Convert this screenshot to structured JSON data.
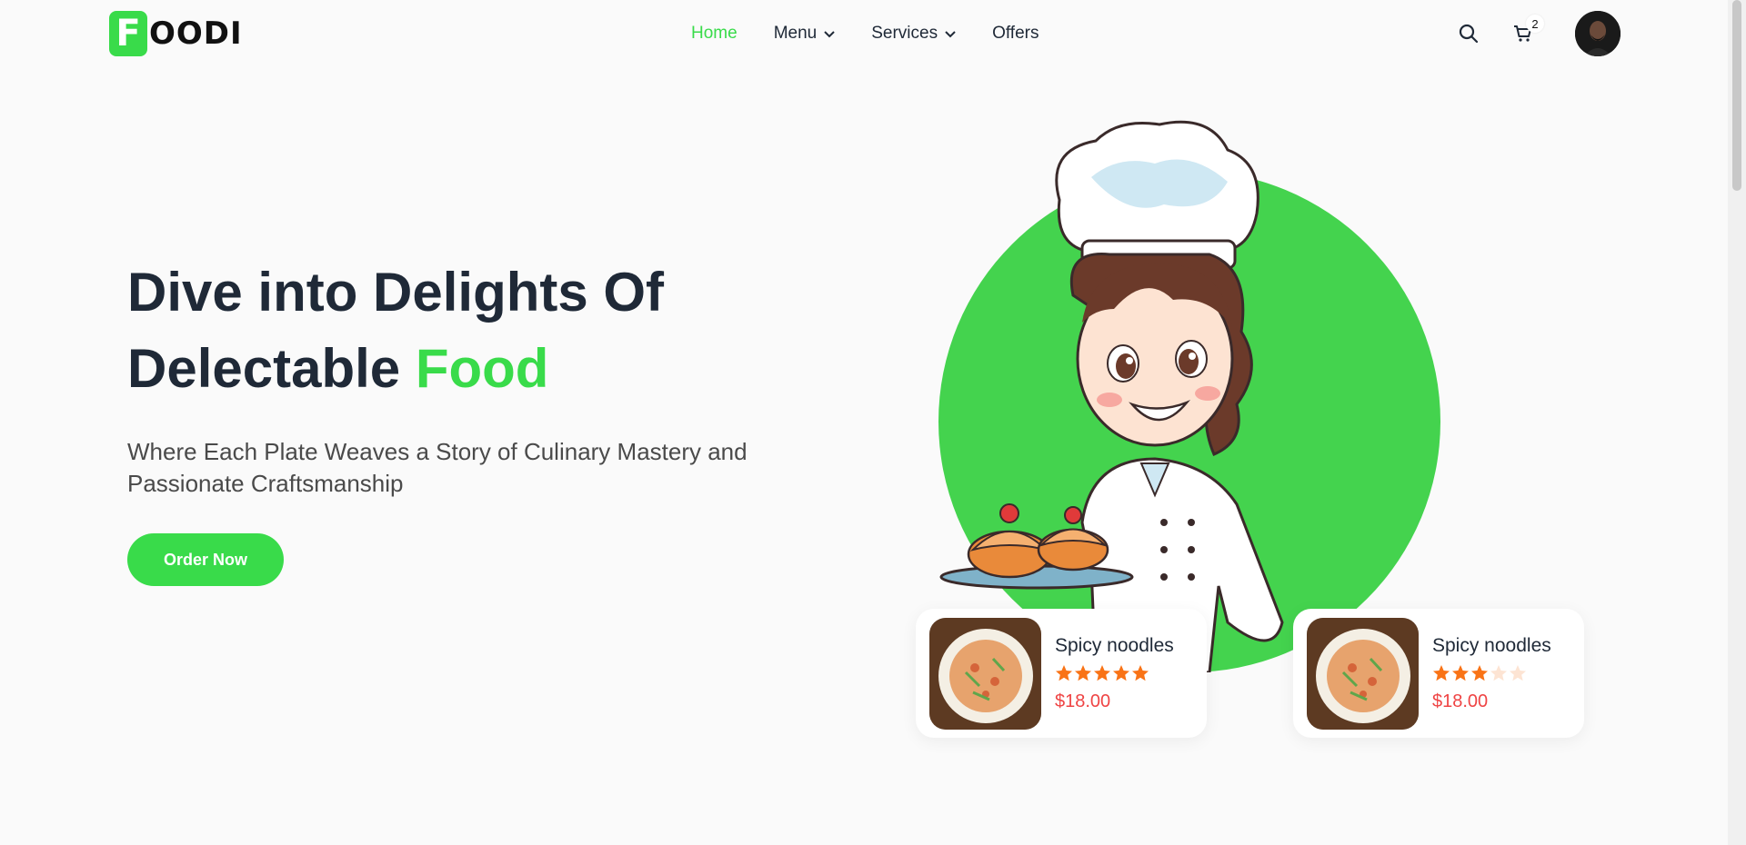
{
  "brand": {
    "letter": "F",
    "name": "OODI"
  },
  "nav": {
    "items": [
      {
        "label": "Home",
        "active": true,
        "dropdown": false
      },
      {
        "label": "Menu",
        "active": false,
        "dropdown": true
      },
      {
        "label": "Services",
        "active": false,
        "dropdown": true
      },
      {
        "label": "Offers",
        "active": false,
        "dropdown": false
      }
    ],
    "cart_count": "2",
    "icons": [
      "search-icon",
      "cart-icon",
      "user-avatar"
    ]
  },
  "hero": {
    "title_line1": "Dive into Delights Of",
    "title_line2_prefix": "Delectable ",
    "title_line2_highlight": "Food",
    "subtitle": "Where Each Plate Weaves a Story of Culinary Mastery and Passionate Craftsmanship",
    "cta_label": "Order Now"
  },
  "cards": [
    {
      "name": "Spicy noodles",
      "rating": 5,
      "price": "$18.00"
    },
    {
      "name": "Spicy noodles",
      "rating": 3,
      "price": "$18.00"
    }
  ],
  "colors": {
    "accent": "#39db4a",
    "price": "#ef4444",
    "star": "#f97316"
  }
}
